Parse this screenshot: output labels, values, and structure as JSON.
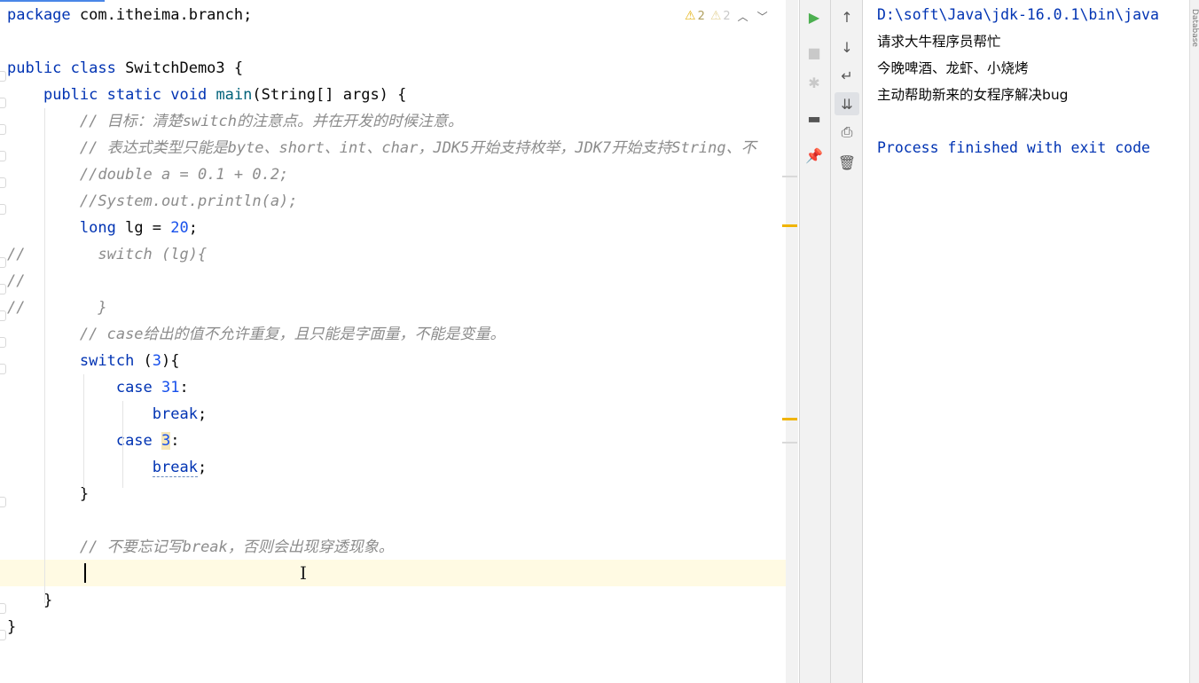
{
  "editor": {
    "lines": [
      [
        [
          "kw",
          "package"
        ],
        [
          "plain",
          " com.itheima.branch;"
        ]
      ],
      [],
      [
        [
          "kw",
          "public class"
        ],
        [
          "plain",
          " SwitchDemo3 {"
        ]
      ],
      [
        [
          "plain",
          "    "
        ],
        [
          "kw",
          "public static void"
        ],
        [
          "plain",
          " "
        ],
        [
          "fn",
          "main"
        ],
        [
          "plain",
          "(String[] args) {"
        ]
      ],
      [
        [
          "plain",
          "        "
        ],
        [
          "cm",
          "// 目标：清楚switch的注意点。并在开发的时候注意。"
        ]
      ],
      [
        [
          "plain",
          "        "
        ],
        [
          "cm",
          "// 表达式类型只能是byte、short、int、char，JDK5开始支持枚举，JDK7开始支持String、不"
        ]
      ],
      [
        [
          "plain",
          "        "
        ],
        [
          "cm",
          "//double a = 0.1 + 0.2;"
        ]
      ],
      [
        [
          "plain",
          "        "
        ],
        [
          "cm",
          "//System.out.println(a);"
        ]
      ],
      [
        [
          "plain",
          "        "
        ],
        [
          "kw",
          "long"
        ],
        [
          "plain",
          " lg = "
        ],
        [
          "num",
          "20"
        ],
        [
          "plain",
          ";"
        ]
      ],
      [
        [
          "cm",
          "//        switch (lg){"
        ]
      ],
      [
        [
          "cm",
          "//"
        ]
      ],
      [
        [
          "cm",
          "//        }"
        ]
      ],
      [
        [
          "plain",
          "        "
        ],
        [
          "cm",
          "// case给出的值不允许重复，且只能是字面量，不能是变量。"
        ]
      ],
      [
        [
          "plain",
          "        "
        ],
        [
          "kw",
          "switch"
        ],
        [
          "plain",
          " ("
        ],
        [
          "num",
          "3"
        ],
        [
          "plain",
          "){"
        ]
      ],
      [
        [
          "plain",
          "            "
        ],
        [
          "kw",
          "case"
        ],
        [
          "plain",
          " "
        ],
        [
          "num",
          "31"
        ],
        [
          "plain",
          ":"
        ]
      ],
      [
        [
          "plain",
          "                "
        ],
        [
          "kw",
          "break"
        ],
        [
          "plain",
          ";"
        ]
      ],
      [
        [
          "plain",
          "            "
        ],
        [
          "kw",
          "case"
        ],
        [
          "plain",
          " "
        ],
        [
          "num hl3",
          "3"
        ],
        [
          "plain",
          ":"
        ]
      ],
      [
        [
          "plain",
          "                "
        ],
        [
          "kw uline",
          "break"
        ],
        [
          "plain",
          ";"
        ]
      ],
      [
        [
          "plain",
          "        }"
        ]
      ],
      [],
      [
        [
          "plain",
          "        "
        ],
        [
          "cm",
          "// 不要忘记写break，否则会出现穿透现象。"
        ]
      ],
      [],
      [
        [
          "plain",
          "    }"
        ]
      ],
      [
        [
          "plain",
          "}"
        ]
      ]
    ]
  },
  "inspections": {
    "warnings": "2",
    "weak_warnings": "2"
  },
  "icons": {
    "warning": "⚠",
    "up": "︿",
    "down": "﹀"
  },
  "run_toolbar": [
    {
      "name": "rerun-icon",
      "glyph": "▶",
      "color": "#4caf50"
    },
    {
      "name": "stop-icon",
      "glyph": "■",
      "color": "#c9c9c9"
    },
    {
      "name": "debug-icon",
      "glyph": "✱",
      "color": "#c9c9c9"
    },
    {
      "name": "layout-icon",
      "glyph": "▬",
      "color": "#555555"
    },
    {
      "name": "pin-icon",
      "glyph": "📌",
      "color": "#555555"
    }
  ],
  "console_toolbar": [
    {
      "name": "scroll-up-icon",
      "glyph": "↑"
    },
    {
      "name": "scroll-down-icon",
      "glyph": "↓"
    },
    {
      "name": "soft-wrap-icon",
      "glyph": "↵"
    },
    {
      "name": "scroll-to-end-icon",
      "glyph": "⇊"
    },
    {
      "name": "print-icon",
      "glyph": "⎙"
    },
    {
      "name": "clear-all-icon",
      "glyph": "🗑"
    }
  ],
  "console": {
    "command": "D:\\soft\\Java\\jdk-16.0.1\\bin\\java",
    "output": [
      "请求大牛程序员帮忙",
      "今晚啤酒、龙虾、小烧烤",
      "主动帮助新来的女程序解决bug"
    ],
    "exit": "Process finished with exit code"
  },
  "side_tool_window": "Database",
  "colors": {
    "keyword": "#0033b3",
    "number": "#1750eb",
    "comment": "#8c8c8c",
    "console_blue": "#0033b3",
    "warning_mark": "#f0b400"
  }
}
